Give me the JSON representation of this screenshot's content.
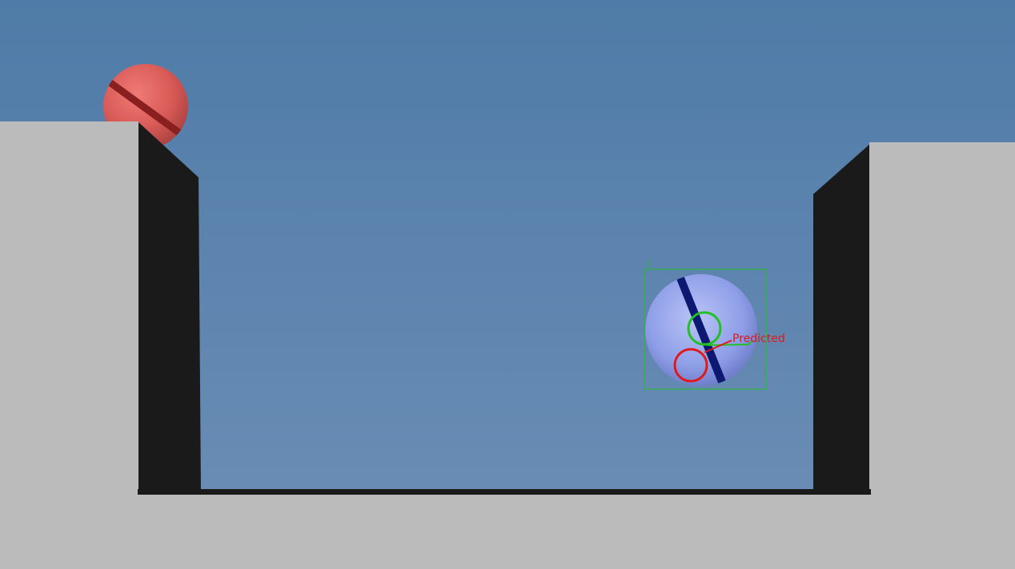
{
  "scene": {
    "sky_color_top": "#4f7ba8",
    "sky_color_bottom": "#6d8fb6",
    "wall_color": "#bbbbbb",
    "shadow_color": "#1a1a1a"
  },
  "red_ball": {
    "color": "#d85a57",
    "stripe_color": "#8a1f1f"
  },
  "blue_ball": {
    "color": "#8f9fe8",
    "stripe_color": "#0d1870"
  },
  "tracking": {
    "box_color": "#22c022",
    "observed_marker_color": "#22c022",
    "predicted_marker_color": "#e01a1a",
    "predicted_label": "Predicted"
  }
}
